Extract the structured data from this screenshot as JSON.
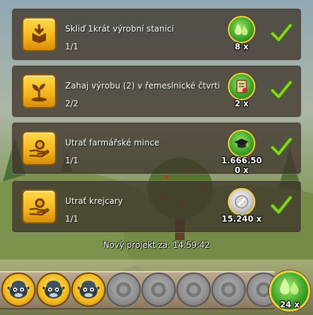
{
  "tasks": [
    {
      "icon": "box-download-icon",
      "title": "Skliď 1krát výrobní stanici",
      "progress": "1/1",
      "reward_icon": "green-drops-icon",
      "reward_amount": "8 x",
      "completed": true
    },
    {
      "icon": "sprout-icon",
      "title": "Zahaj výrobu (2) v řemeslnické čtvrti",
      "progress": "2/2",
      "reward_icon": "craft-scroll-icon",
      "reward_amount": "2 x",
      "completed": true
    },
    {
      "icon": "hand-coin-icon",
      "title": "Utrať farmářské mince",
      "progress": "1/1",
      "reward_icon": "graduation-cap-icon",
      "reward_amount": "1.666.50",
      "reward_sub": "0 x",
      "completed": true
    },
    {
      "icon": "hand-coin-icon",
      "title": "Utrať krejcary",
      "progress": "1/1",
      "reward_icon": "silver-coin-icon",
      "reward_amount": "15.240 x",
      "completed": true
    }
  ],
  "timer": "Nový projekt za: 14:59:42",
  "progress_slots": {
    "filled": 3,
    "total": 8
  },
  "total_reward": {
    "icon": "green-drops-icon",
    "amount": "24 x"
  },
  "colors": {
    "check_green": "#8bd12a",
    "icon_gold": "#f2b41b",
    "reward_green": "#3fa52a"
  }
}
